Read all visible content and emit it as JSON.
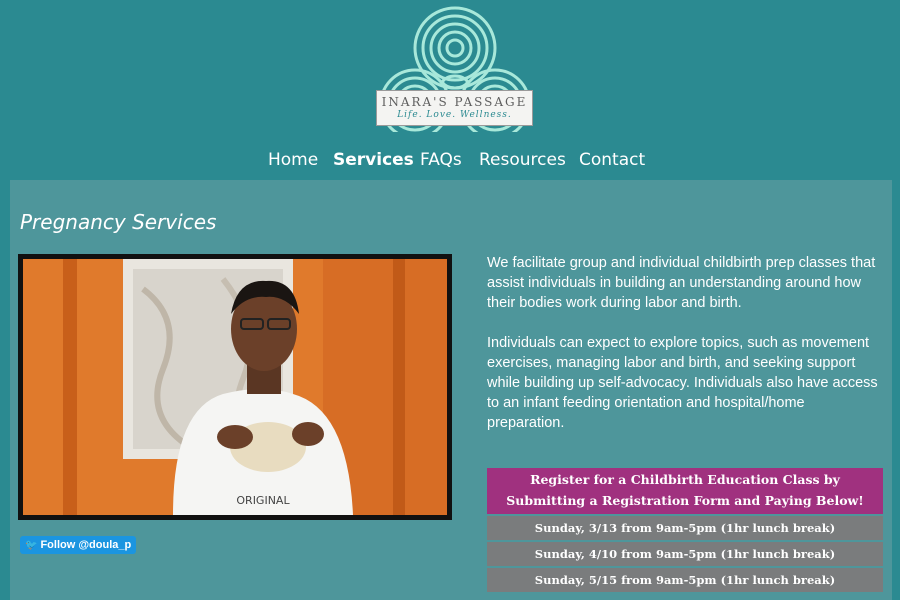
{
  "logo": {
    "name": "INARA'S PASSAGE",
    "tagline": "Life. Love. Wellness.",
    "icon": "triple-spiral-icon"
  },
  "nav": {
    "items": [
      {
        "label": "Home",
        "active": false
      },
      {
        "label": "Services",
        "active": true
      },
      {
        "label": "FAQs",
        "active": false
      },
      {
        "label": "Resources",
        "active": false
      },
      {
        "label": "Contact",
        "active": false
      }
    ]
  },
  "main": {
    "title": "Pregnancy Services",
    "paragraphs": [
      "We facilitate group and individual childbirth prep classes that assist individuals in building an understanding around how their bodies work during labor and birth.",
      "Individuals can expect to explore topics, such as movement exercises, managing labor and birth, and seeking support while building up self-advocacy. Individuals also have access to an infant feeding orientation and hospital/home preparation."
    ]
  },
  "twitter": {
    "label": "Follow @doula_p",
    "icon": "twitter-bird-icon"
  },
  "registration": {
    "header_line1": "Register for a Childbirth Education Class by",
    "header_line2": "Submitting a Registration Form and Paying Below!",
    "sessions": [
      "Sunday, 3/13 from 9am-5pm (1hr lunch break)",
      "Sunday, 4/10 from 9am-5pm (1hr lunch break)",
      "Sunday, 5/15 from 9am-5pm (1hr lunch break)"
    ]
  },
  "colors": {
    "background": "#2b8a91",
    "panel": "#4e969b",
    "register_header": "#a0317f",
    "session_row": "#7a7c7d",
    "twitter": "#1b95e0"
  }
}
